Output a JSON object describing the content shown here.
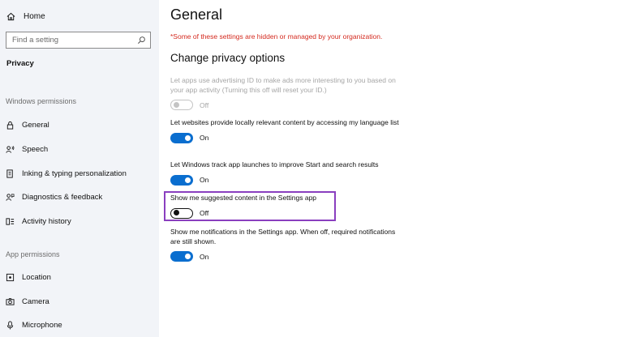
{
  "sidebar": {
    "home_label": "Home",
    "search_placeholder": "Find a setting",
    "current_section": "Privacy",
    "windows_permissions_header": "Windows permissions",
    "windows_items": [
      {
        "label": "General",
        "icon": "lock-icon"
      },
      {
        "label": "Speech",
        "icon": "speech-icon"
      },
      {
        "label": "Inking & typing personalization",
        "icon": "inking-icon"
      },
      {
        "label": "Diagnostics & feedback",
        "icon": "feedback-icon"
      },
      {
        "label": "Activity history",
        "icon": "activity-icon"
      }
    ],
    "app_permissions_header": "App permissions",
    "app_items": [
      {
        "label": "Location",
        "icon": "location-icon"
      },
      {
        "label": "Camera",
        "icon": "camera-icon"
      },
      {
        "label": "Microphone",
        "icon": "microphone-icon"
      }
    ]
  },
  "main": {
    "title": "General",
    "managed_note": "*Some of these settings are hidden or managed by your organization.",
    "section_title": "Change privacy options",
    "settings": [
      {
        "description": "Let apps use advertising ID to make ads more interesting to you based on your app activity (Turning this off will reset your ID.)",
        "state": "Off",
        "enabled": false
      },
      {
        "description": "Let websites provide locally relevant content by accessing my language list",
        "state": "On",
        "enabled": true
      },
      {
        "description": "Let Windows track app launches to improve Start and search results",
        "state": "On",
        "enabled": true
      },
      {
        "description": "Show me suggested content in the Settings app",
        "state": "Off",
        "enabled": true
      },
      {
        "description": "Show me notifications in the Settings app. When off, required notifications are still shown.",
        "state": "On",
        "enabled": true
      }
    ]
  },
  "colors": {
    "accent": "#0a6ecf",
    "warning": "#d42a1f",
    "highlight_border": "#8a3fbf",
    "sidebar_bg": "#f2f4f8"
  }
}
